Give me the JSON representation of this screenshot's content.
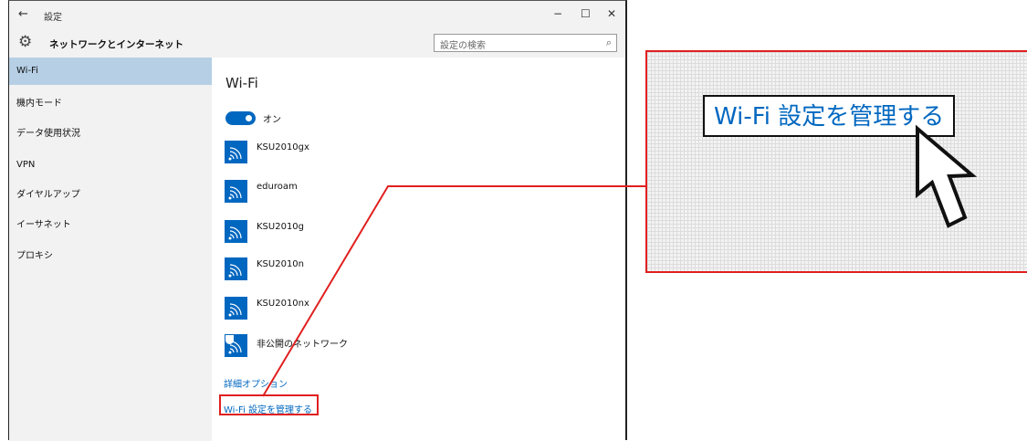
{
  "window": {
    "back_glyph": "←",
    "title": "設定",
    "minimize_glyph": "−",
    "maximize_glyph": "☐",
    "close_glyph": "✕"
  },
  "header": {
    "gear_glyph": "⚙",
    "title": "ネットワークとインターネット",
    "search_placeholder": "設定の検索",
    "search_glyph": "⌕"
  },
  "sidebar": {
    "items": [
      {
        "label": "Wi-Fi",
        "active": true
      },
      {
        "label": "機内モード",
        "active": false
      },
      {
        "label": "データ使用状況",
        "active": false
      },
      {
        "label": "VPN",
        "active": false
      },
      {
        "label": "ダイヤルアップ",
        "active": false
      },
      {
        "label": "イーサネット",
        "active": false
      },
      {
        "label": "プロキシ",
        "active": false
      }
    ]
  },
  "main": {
    "title": "Wi-Fi",
    "toggle_label": "オン",
    "networks": [
      {
        "name": "KSU2010gx",
        "secured": false
      },
      {
        "name": "eduroam",
        "secured": false
      },
      {
        "name": "KSU2010g",
        "secured": false
      },
      {
        "name": "KSU2010n",
        "secured": false
      },
      {
        "name": "KSU2010nx",
        "secured": false
      },
      {
        "name": "非公開のネットワーク",
        "secured": true
      }
    ],
    "advanced_link": "詳細オプション",
    "manage_link": "Wi-Fi 設定を管理する"
  },
  "callout": {
    "zoom_text": "Wi-Fi 設定を管理する"
  },
  "colors": {
    "accent": "#0067c0",
    "highlight": "#e02020",
    "sidebar_active": "#b6cfe5",
    "chrome": "#f2f2f2"
  }
}
